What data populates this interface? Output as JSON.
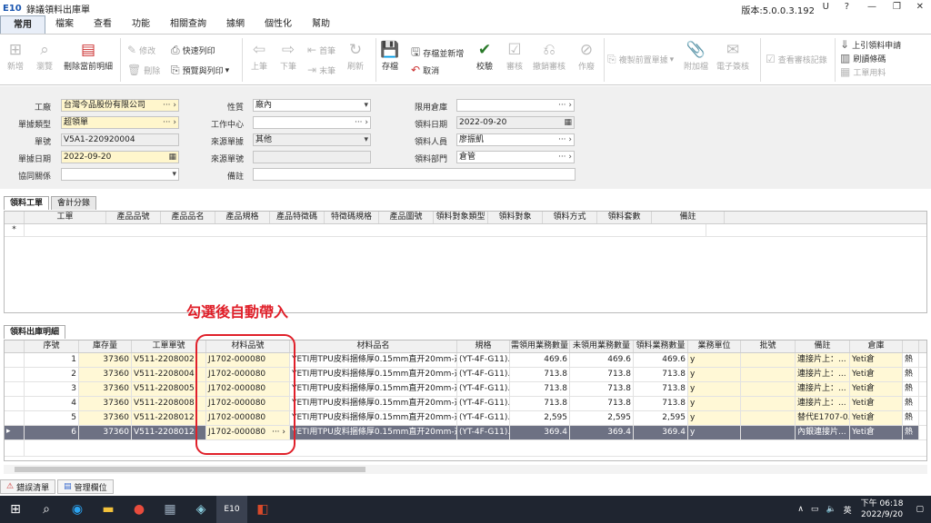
{
  "window": {
    "logo": "E10",
    "title": "錄議領料出庫單",
    "version": "版本:5.0.0.3.192",
    "user": "U"
  },
  "menu": [
    "常用",
    "檔案",
    "查看",
    "功能",
    "相關查詢",
    "據網",
    "個性化",
    "幫助"
  ],
  "ribbon": {
    "new": "新增",
    "browse": "瀏覽",
    "delete_detail": "刪除當前明細",
    "modify": "修改",
    "delete": "刪除",
    "quick_print": "快速列印",
    "preview_print": "預覽與列印",
    "prev": "上筆",
    "next": "下筆",
    "first": "首筆",
    "last": "末筆",
    "refresh": "刷新",
    "save": "存檔",
    "save_new": "存檔並新增",
    "cancel": "取消",
    "validate": "校驗",
    "approve": "審核",
    "unapprove": "撤銷審核",
    "void": "作廢",
    "copy_prev": "複製前置單據",
    "attach": "附加檔",
    "esign": "電子簽核",
    "view_audit": "查看審核記錄",
    "pull_req": "上引領料申請",
    "batch_fetch": "刷讀條碼",
    "work_material": "工單用料"
  },
  "form": {
    "factory_label": "工廠",
    "factory": "台灣今品股份有限公司",
    "doc_type_label": "單據類型",
    "doc_type": "超領單",
    "doc_no_label": "單號",
    "doc_no": "V5A1-220920004",
    "doc_date_label": "單據日期",
    "doc_date": "2022-09-20",
    "collab_label": "協同關係",
    "nature_label": "性質",
    "nature": "廠內",
    "workcenter_label": "工作中心",
    "source_type_label": "來源單據",
    "source_type": "其他",
    "source_no_label": "來源單號",
    "remark_label": "備註",
    "limit_wh_label": "限用倉庫",
    "pick_date_label": "領料日期",
    "pick_date": "2022-09-20",
    "picker_label": "領料人員",
    "picker": "廖振凱",
    "pick_dept_label": "領料部門",
    "pick_dept": "倉管"
  },
  "tabs1": [
    "領料工單",
    "會計分錄"
  ],
  "grid1": {
    "columns": [
      "工單",
      "產品品號",
      "產品品名",
      "產品規格",
      "產品特徵碼",
      "特徵碼規格",
      "產品圖號",
      "領料對象類型",
      "領料對象",
      "領料方式",
      "領料套數",
      "備註"
    ],
    "new_row": "*"
  },
  "annotation": "勾選後自動帶入",
  "tabs2": [
    "領料出庫明細"
  ],
  "grid2": {
    "columns": [
      "序號",
      "庫存量",
      "工單單號",
      "材料品號",
      "材料品名",
      "規格",
      "需領用業務數量",
      "未領用業務數量",
      "領料業務數量",
      "業務單位",
      "批號",
      "備註",
      "倉庫",
      ""
    ],
    "rows": [
      [
        "1",
        "37360",
        "V511-2208002",
        "J1702-000080",
        "YETI用TPU皮料捆條厚0.15mm直开20mm-透明",
        "(YT-4F-G11)...",
        "469.6",
        "469.6",
        "469.6",
        "y",
        "",
        "連接片上：...",
        "Yeti倉",
        "熱"
      ],
      [
        "2",
        "37360",
        "V511-2208004",
        "J1702-000080",
        "YETI用TPU皮料捆條厚0.15mm直开20mm-透明",
        "(YT-4F-G11)...",
        "713.8",
        "713.8",
        "713.8",
        "y",
        "",
        "連接片上：...",
        "Yeti倉",
        "熱"
      ],
      [
        "3",
        "37360",
        "V511-2208005",
        "J1702-000080",
        "YETI用TPU皮料捆條厚0.15mm直开20mm-透明",
        "(YT-4F-G11)...",
        "713.8",
        "713.8",
        "713.8",
        "y",
        "",
        "連接片上：...",
        "Yeti倉",
        "熱"
      ],
      [
        "4",
        "37360",
        "V511-2208008",
        "J1702-000080",
        "YETI用TPU皮料捆條厚0.15mm直开20mm-透明",
        "(YT-4F-G11)...",
        "713.8",
        "713.8",
        "713.8",
        "y",
        "",
        "連接片上：...",
        "Yeti倉",
        "熱"
      ],
      [
        "5",
        "37360",
        "V511-2208012",
        "J1702-000080",
        "YETI用TPU皮料捆條厚0.15mm直开20mm-透明",
        "(YT-4F-G11)...",
        "2,595",
        "2,595",
        "2,595",
        "y",
        "",
        "替代E1707-0...",
        "Yeti倉",
        "熱"
      ],
      [
        "6",
        "37360",
        "V511-2208012",
        "J1702-000080",
        "YETI用TPU皮料捆條厚0.15mm直开20mm-透明",
        "(YT-4F-G11)...",
        "369.4",
        "369.4",
        "369.4",
        "y",
        "",
        "內銀連接片...",
        "Yeti倉",
        "熱"
      ]
    ]
  },
  "bottom_tabs": [
    "錯誤清單",
    "管理欄位"
  ],
  "taskbar": {
    "time": "下午 06:18",
    "date": "2022/9/20",
    "ime": "英",
    "app": "E10"
  }
}
